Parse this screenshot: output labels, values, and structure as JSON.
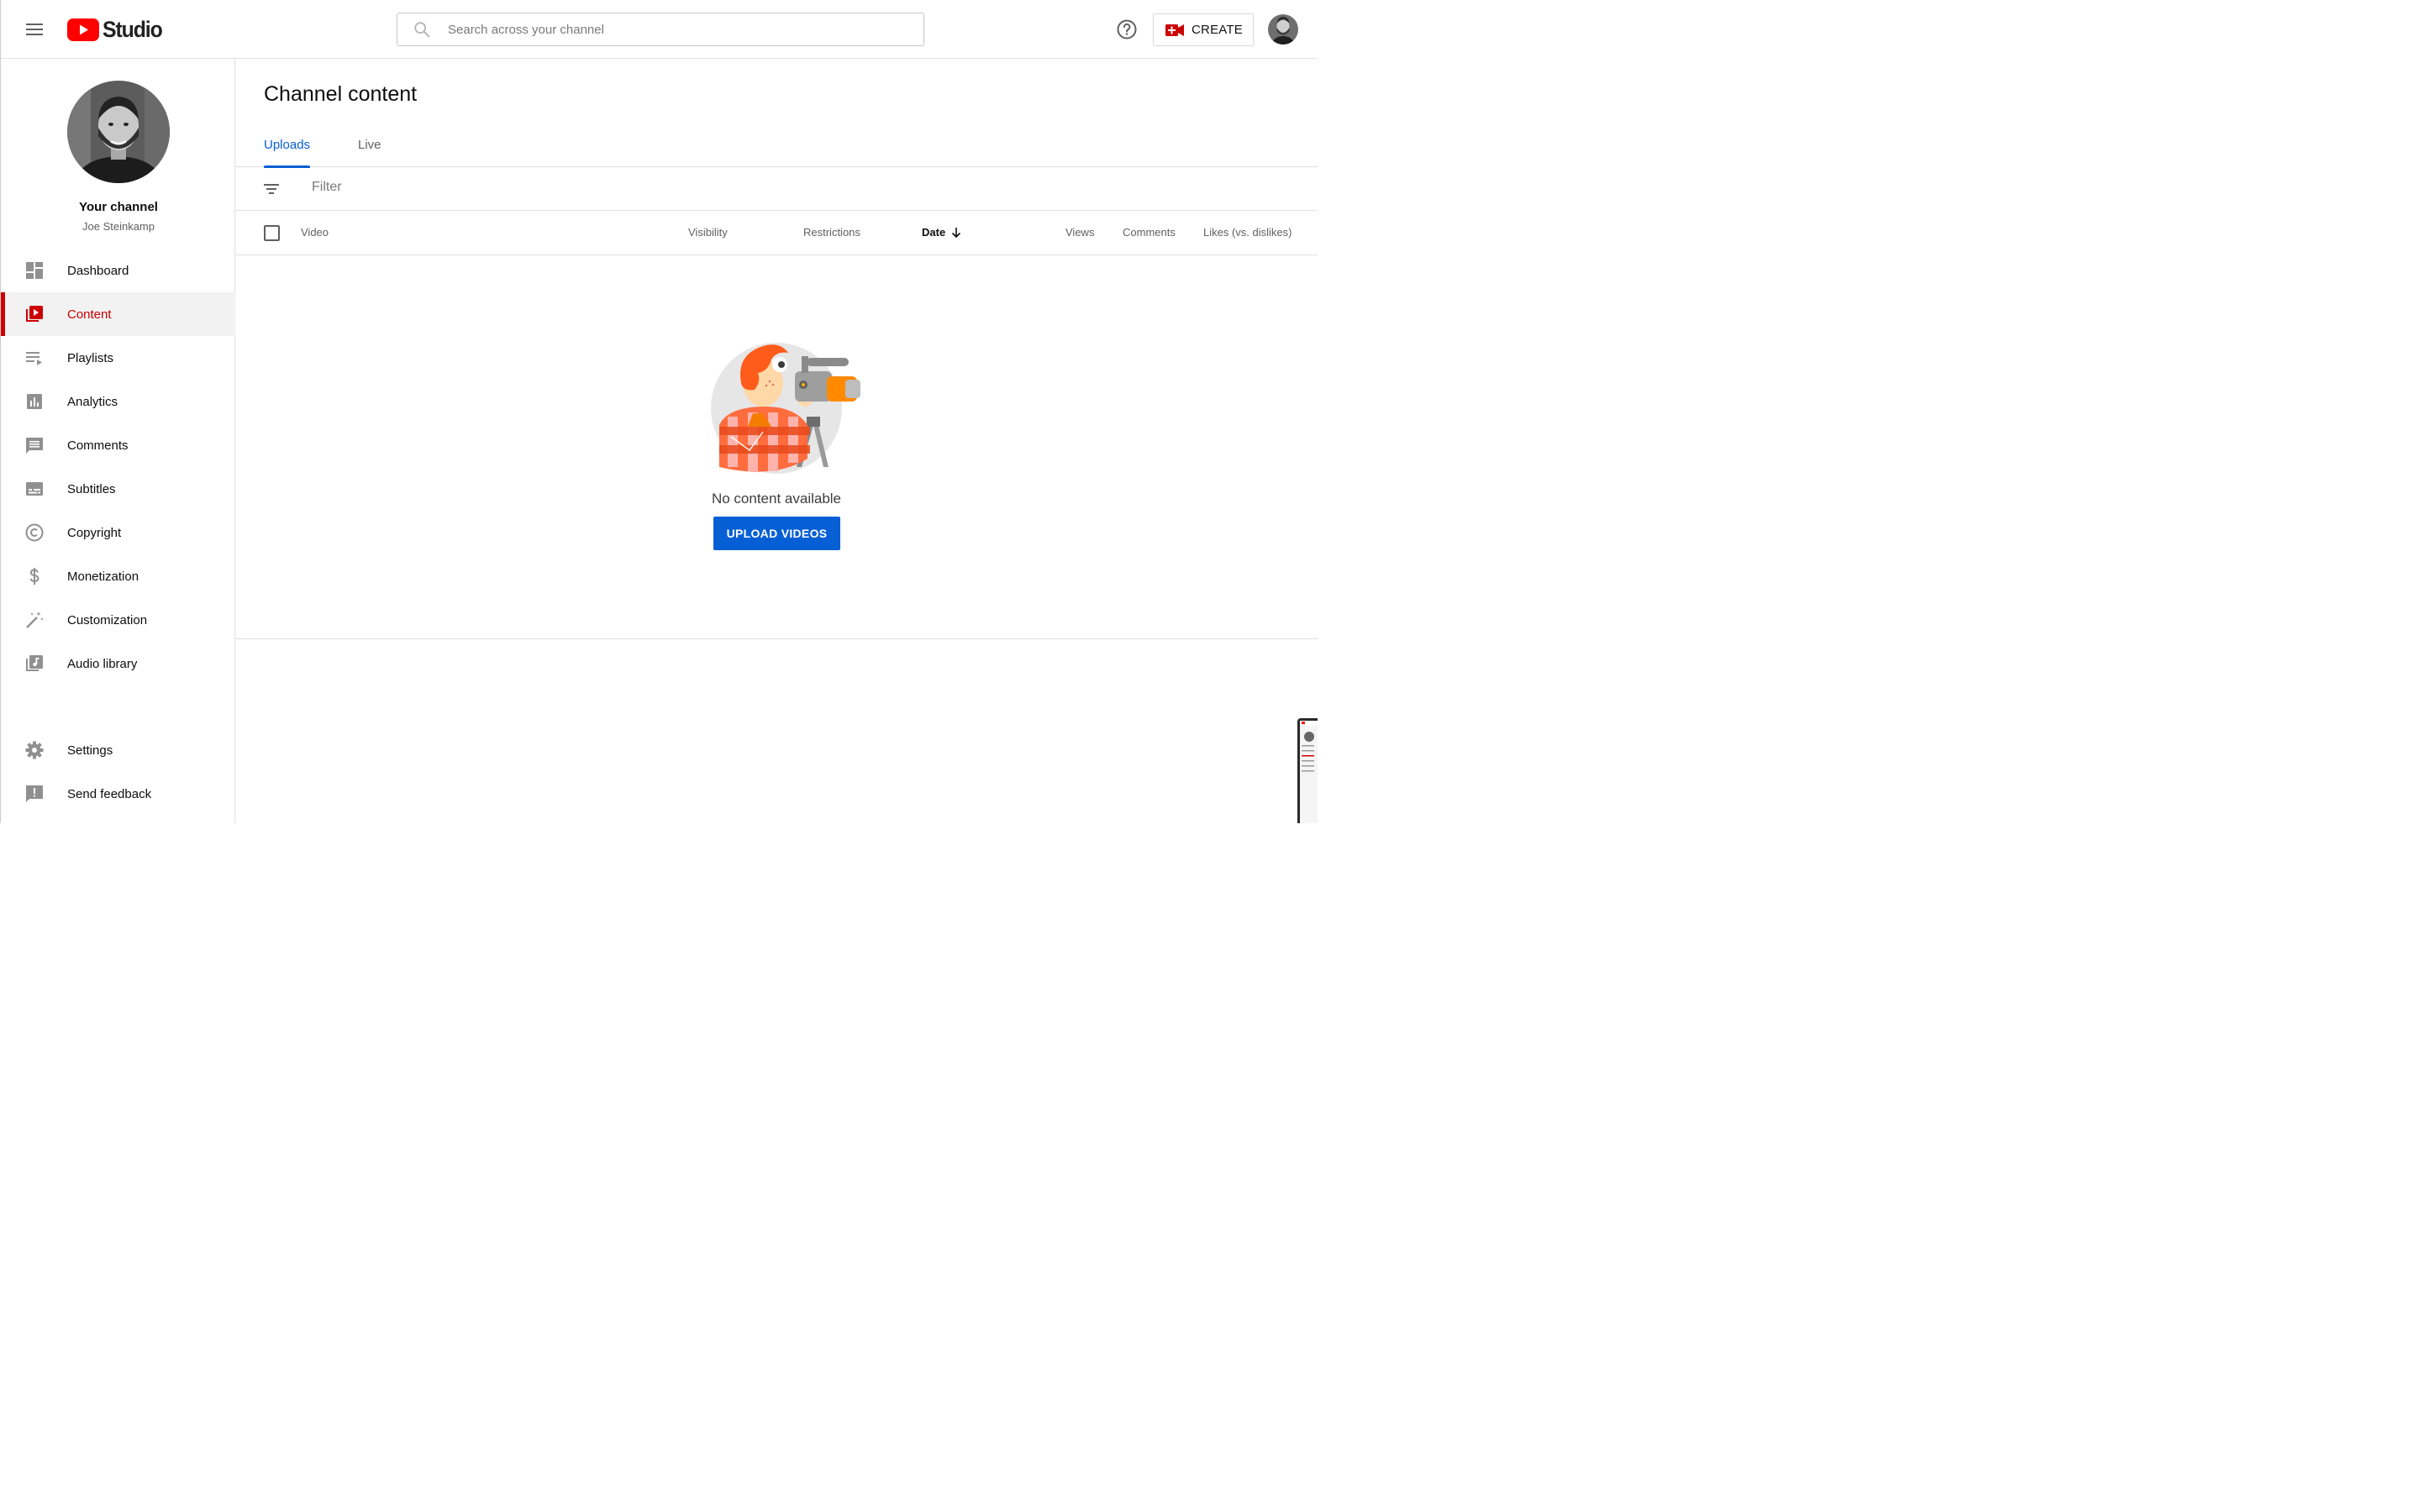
{
  "header": {
    "logo_text": "Studio",
    "search_placeholder": "Search across your channel",
    "create_label": "CREATE"
  },
  "sidebar": {
    "channel_title": "Your channel",
    "channel_name": "Joe Steinkamp",
    "items": [
      {
        "label": "Dashboard",
        "icon": "dashboard-icon"
      },
      {
        "label": "Content",
        "icon": "content-icon",
        "active": true
      },
      {
        "label": "Playlists",
        "icon": "playlists-icon"
      },
      {
        "label": "Analytics",
        "icon": "analytics-icon"
      },
      {
        "label": "Comments",
        "icon": "comments-icon"
      },
      {
        "label": "Subtitles",
        "icon": "subtitles-icon"
      },
      {
        "label": "Copyright",
        "icon": "copyright-icon"
      },
      {
        "label": "Monetization",
        "icon": "monetization-icon"
      },
      {
        "label": "Customization",
        "icon": "customization-icon"
      },
      {
        "label": "Audio library",
        "icon": "audio-library-icon"
      }
    ],
    "bottom_items": [
      {
        "label": "Settings",
        "icon": "settings-icon"
      },
      {
        "label": "Send feedback",
        "icon": "feedback-icon"
      }
    ]
  },
  "main": {
    "title": "Channel content",
    "tabs": [
      {
        "label": "Uploads",
        "active": true
      },
      {
        "label": "Live"
      }
    ],
    "filter_placeholder": "Filter",
    "columns": [
      "Video",
      "Visibility",
      "Restrictions",
      "Date",
      "Views",
      "Comments",
      "Likes (vs. dislikes)"
    ],
    "sorted_column": "Date",
    "empty_message": "No content available",
    "upload_button": "UPLOAD VIDEOS"
  },
  "colors": {
    "accent_red": "#cc0000",
    "accent_blue": "#065fd4"
  }
}
